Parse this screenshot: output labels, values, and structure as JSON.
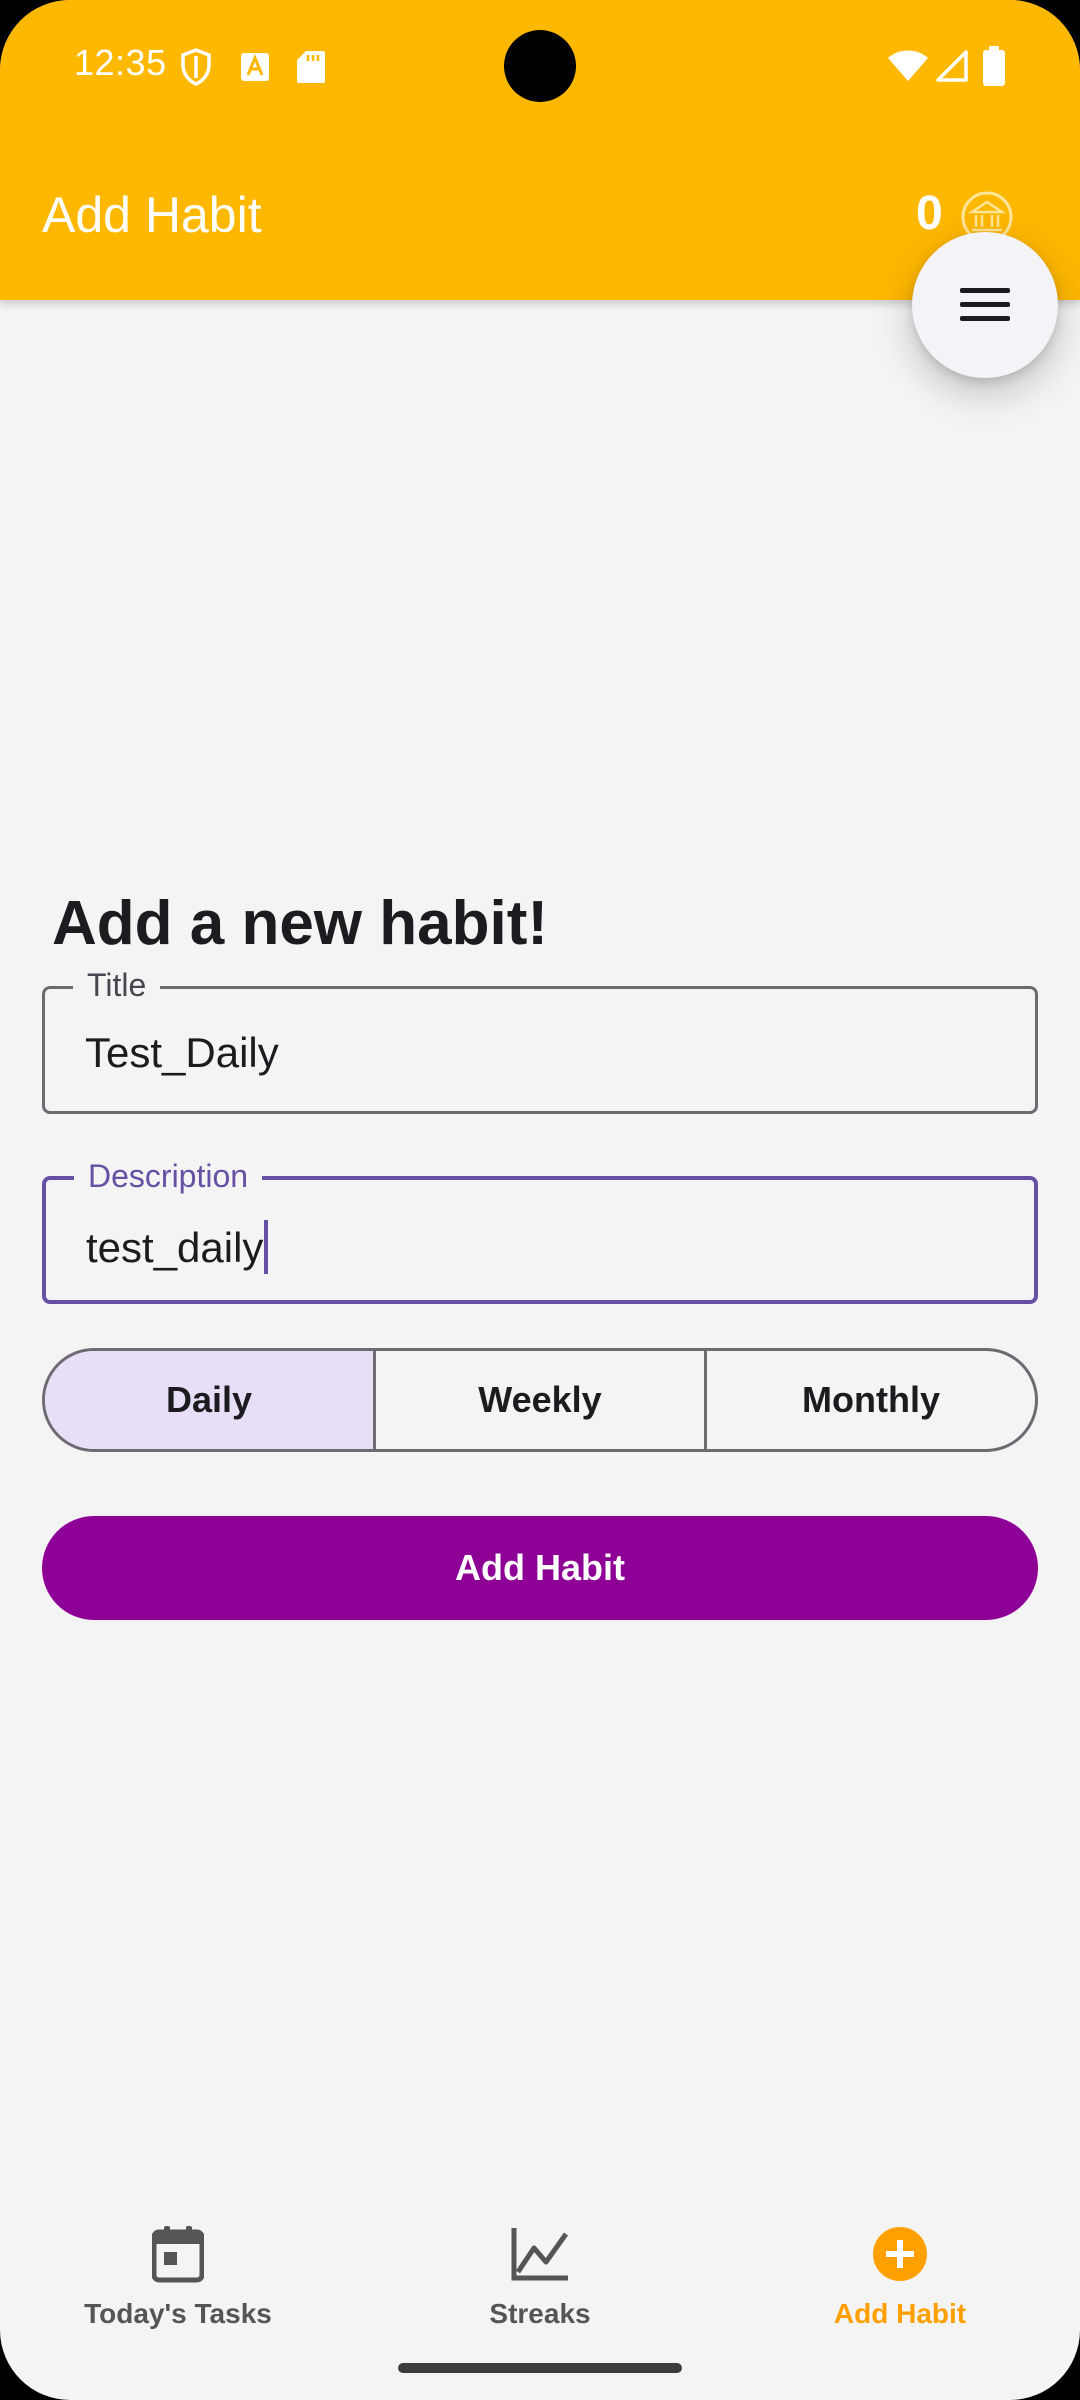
{
  "status_bar": {
    "time": "12:35",
    "icons": [
      "shield-icon",
      "a-icon",
      "sd-card-icon",
      "wifi-icon",
      "signal-icon",
      "battery-icon"
    ]
  },
  "app_bar": {
    "title": "Add Habit",
    "coin_count": "0",
    "coin_icon": "bank-coin-icon",
    "menu_icon": "menu-icon",
    "color": "#ffb800"
  },
  "form": {
    "heading": "Add a new habit!",
    "title_field": {
      "label": "Title",
      "value": "Test_Daily"
    },
    "description_field": {
      "label": "Description",
      "value": "test_daily",
      "focused": true
    },
    "frequency": {
      "options": [
        "Daily",
        "Weekly",
        "Monthly"
      ],
      "selected": "Daily"
    },
    "submit_label": "Add Habit",
    "submit_color": "#8e0095"
  },
  "bottom_nav": {
    "items": [
      {
        "label": "Today's Tasks",
        "icon": "calendar-icon"
      },
      {
        "label": "Streaks",
        "icon": "chart-line-icon"
      },
      {
        "label": "Add Habit",
        "icon": "add-circle-icon",
        "active": true
      }
    ],
    "active_color": "#ffa000"
  }
}
